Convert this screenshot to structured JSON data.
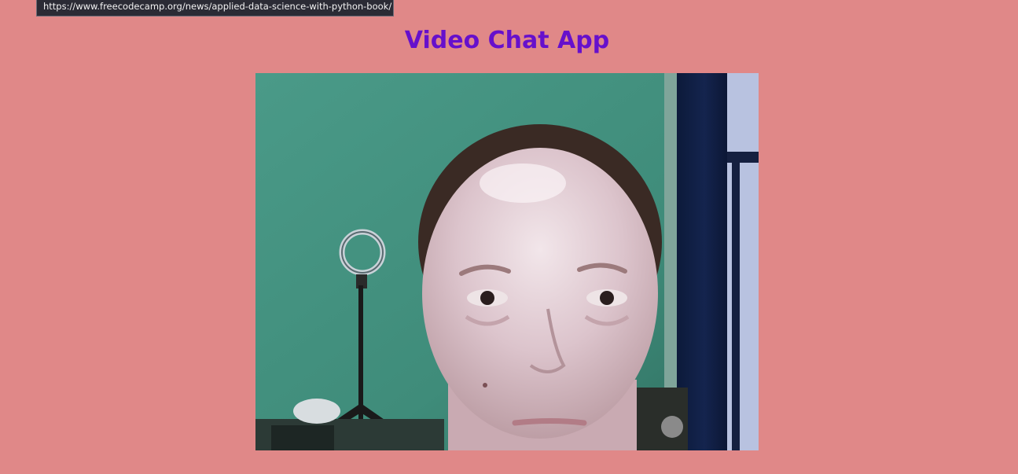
{
  "status_tooltip": {
    "url": "https://www.freecodecamp.org/news/applied-data-science-with-python-book/"
  },
  "page": {
    "title": "Video Chat App"
  },
  "video": {
    "icon": "webcam-feed"
  },
  "colors": {
    "background": "#e08888",
    "title": "#6610cc",
    "tooltip_background": "#2b2b35"
  }
}
